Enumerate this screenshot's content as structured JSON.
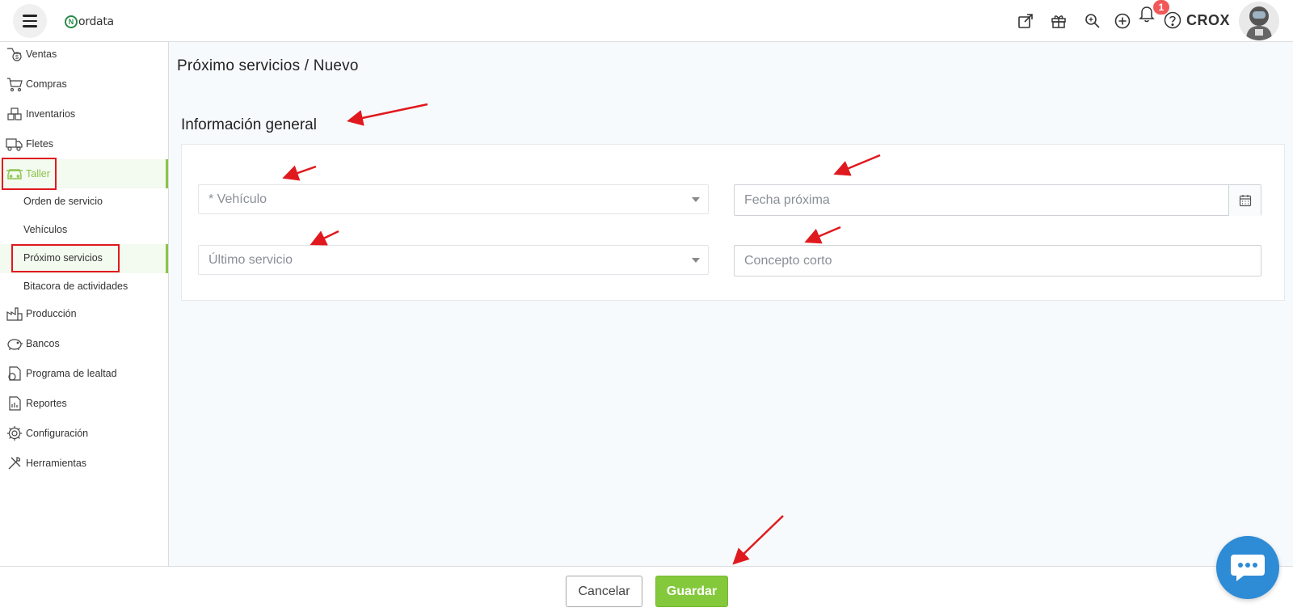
{
  "header": {
    "logo_text": "ordata",
    "logo_letter": "N",
    "notification_count": "1",
    "username": "CROX",
    "icons": [
      "external-link-icon",
      "gift-icon",
      "search-zoom-icon",
      "plus-circle-icon",
      "bell-icon",
      "help-icon"
    ]
  },
  "sidebar": {
    "items": [
      {
        "label": "Ventas",
        "icon": "sales-icon"
      },
      {
        "label": "Compras",
        "icon": "cart-icon"
      },
      {
        "label": "Inventarios",
        "icon": "boxes-icon"
      },
      {
        "label": "Fletes",
        "icon": "truck-icon"
      },
      {
        "label": "Taller",
        "icon": "car-icon"
      },
      {
        "label": "Producción",
        "icon": "factory-icon"
      },
      {
        "label": "Bancos",
        "icon": "piggy-bank-icon"
      },
      {
        "label": "Programa de lealtad",
        "icon": "loyalty-icon"
      },
      {
        "label": "Reportes",
        "icon": "report-icon"
      },
      {
        "label": "Configuración",
        "icon": "gear-icon"
      },
      {
        "label": "Herramientas",
        "icon": "tools-icon"
      }
    ],
    "taller_sub": [
      "Orden de servicio",
      "Vehículos",
      "Próximo servicios",
      "Bitacora de actividades"
    ],
    "active_item": "Taller",
    "active_sub": "Próximo servicios"
  },
  "main": {
    "breadcrumb": "Próximo servicios /  Nuevo",
    "section_title": "Información general",
    "fields": {
      "vehiculo_placeholder": "* Vehículo",
      "fecha_placeholder": "Fecha próxima",
      "ultimo_placeholder": "Último servicio",
      "concepto_placeholder": "Concepto corto"
    }
  },
  "footer": {
    "cancel_label": "Cancelar",
    "save_label": "Guardar"
  },
  "colors": {
    "accent": "#84c93c",
    "annotation_red": "#e0191e",
    "badge": "#f25858",
    "chat": "#2e8bd6"
  }
}
